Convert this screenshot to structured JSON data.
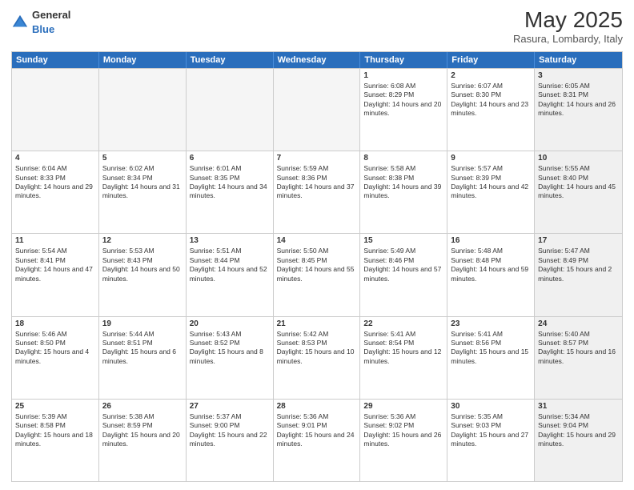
{
  "header": {
    "logo_general": "General",
    "logo_blue": "Blue",
    "main_title": "May 2025",
    "subtitle": "Rasura, Lombardy, Italy"
  },
  "calendar": {
    "days_of_week": [
      "Sunday",
      "Monday",
      "Tuesday",
      "Wednesday",
      "Thursday",
      "Friday",
      "Saturday"
    ],
    "rows": [
      [
        {
          "day": "",
          "empty": true
        },
        {
          "day": "",
          "empty": true
        },
        {
          "day": "",
          "empty": true
        },
        {
          "day": "",
          "empty": true
        },
        {
          "day": "1",
          "sunrise": "6:08 AM",
          "sunset": "8:29 PM",
          "daylight": "14 hours and 20 minutes."
        },
        {
          "day": "2",
          "sunrise": "6:07 AM",
          "sunset": "8:30 PM",
          "daylight": "14 hours and 23 minutes."
        },
        {
          "day": "3",
          "sunrise": "6:05 AM",
          "sunset": "8:31 PM",
          "daylight": "14 hours and 26 minutes.",
          "shaded": true
        }
      ],
      [
        {
          "day": "4",
          "sunrise": "6:04 AM",
          "sunset": "8:33 PM",
          "daylight": "14 hours and 29 minutes."
        },
        {
          "day": "5",
          "sunrise": "6:02 AM",
          "sunset": "8:34 PM",
          "daylight": "14 hours and 31 minutes."
        },
        {
          "day": "6",
          "sunrise": "6:01 AM",
          "sunset": "8:35 PM",
          "daylight": "14 hours and 34 minutes."
        },
        {
          "day": "7",
          "sunrise": "5:59 AM",
          "sunset": "8:36 PM",
          "daylight": "14 hours and 37 minutes."
        },
        {
          "day": "8",
          "sunrise": "5:58 AM",
          "sunset": "8:38 PM",
          "daylight": "14 hours and 39 minutes."
        },
        {
          "day": "9",
          "sunrise": "5:57 AM",
          "sunset": "8:39 PM",
          "daylight": "14 hours and 42 minutes."
        },
        {
          "day": "10",
          "sunrise": "5:55 AM",
          "sunset": "8:40 PM",
          "daylight": "14 hours and 45 minutes.",
          "shaded": true
        }
      ],
      [
        {
          "day": "11",
          "sunrise": "5:54 AM",
          "sunset": "8:41 PM",
          "daylight": "14 hours and 47 minutes."
        },
        {
          "day": "12",
          "sunrise": "5:53 AM",
          "sunset": "8:43 PM",
          "daylight": "14 hours and 50 minutes."
        },
        {
          "day": "13",
          "sunrise": "5:51 AM",
          "sunset": "8:44 PM",
          "daylight": "14 hours and 52 minutes."
        },
        {
          "day": "14",
          "sunrise": "5:50 AM",
          "sunset": "8:45 PM",
          "daylight": "14 hours and 55 minutes."
        },
        {
          "day": "15",
          "sunrise": "5:49 AM",
          "sunset": "8:46 PM",
          "daylight": "14 hours and 57 minutes."
        },
        {
          "day": "16",
          "sunrise": "5:48 AM",
          "sunset": "8:48 PM",
          "daylight": "14 hours and 59 minutes."
        },
        {
          "day": "17",
          "sunrise": "5:47 AM",
          "sunset": "8:49 PM",
          "daylight": "15 hours and 2 minutes.",
          "shaded": true
        }
      ],
      [
        {
          "day": "18",
          "sunrise": "5:46 AM",
          "sunset": "8:50 PM",
          "daylight": "15 hours and 4 minutes."
        },
        {
          "day": "19",
          "sunrise": "5:44 AM",
          "sunset": "8:51 PM",
          "daylight": "15 hours and 6 minutes."
        },
        {
          "day": "20",
          "sunrise": "5:43 AM",
          "sunset": "8:52 PM",
          "daylight": "15 hours and 8 minutes."
        },
        {
          "day": "21",
          "sunrise": "5:42 AM",
          "sunset": "8:53 PM",
          "daylight": "15 hours and 10 minutes."
        },
        {
          "day": "22",
          "sunrise": "5:41 AM",
          "sunset": "8:54 PM",
          "daylight": "15 hours and 12 minutes."
        },
        {
          "day": "23",
          "sunrise": "5:41 AM",
          "sunset": "8:56 PM",
          "daylight": "15 hours and 15 minutes."
        },
        {
          "day": "24",
          "sunrise": "5:40 AM",
          "sunset": "8:57 PM",
          "daylight": "15 hours and 16 minutes.",
          "shaded": true
        }
      ],
      [
        {
          "day": "25",
          "sunrise": "5:39 AM",
          "sunset": "8:58 PM",
          "daylight": "15 hours and 18 minutes."
        },
        {
          "day": "26",
          "sunrise": "5:38 AM",
          "sunset": "8:59 PM",
          "daylight": "15 hours and 20 minutes."
        },
        {
          "day": "27",
          "sunrise": "5:37 AM",
          "sunset": "9:00 PM",
          "daylight": "15 hours and 22 minutes."
        },
        {
          "day": "28",
          "sunrise": "5:36 AM",
          "sunset": "9:01 PM",
          "daylight": "15 hours and 24 minutes."
        },
        {
          "day": "29",
          "sunrise": "5:36 AM",
          "sunset": "9:02 PM",
          "daylight": "15 hours and 26 minutes."
        },
        {
          "day": "30",
          "sunrise": "5:35 AM",
          "sunset": "9:03 PM",
          "daylight": "15 hours and 27 minutes."
        },
        {
          "day": "31",
          "sunrise": "5:34 AM",
          "sunset": "9:04 PM",
          "daylight": "15 hours and 29 minutes.",
          "shaded": true
        }
      ]
    ]
  }
}
